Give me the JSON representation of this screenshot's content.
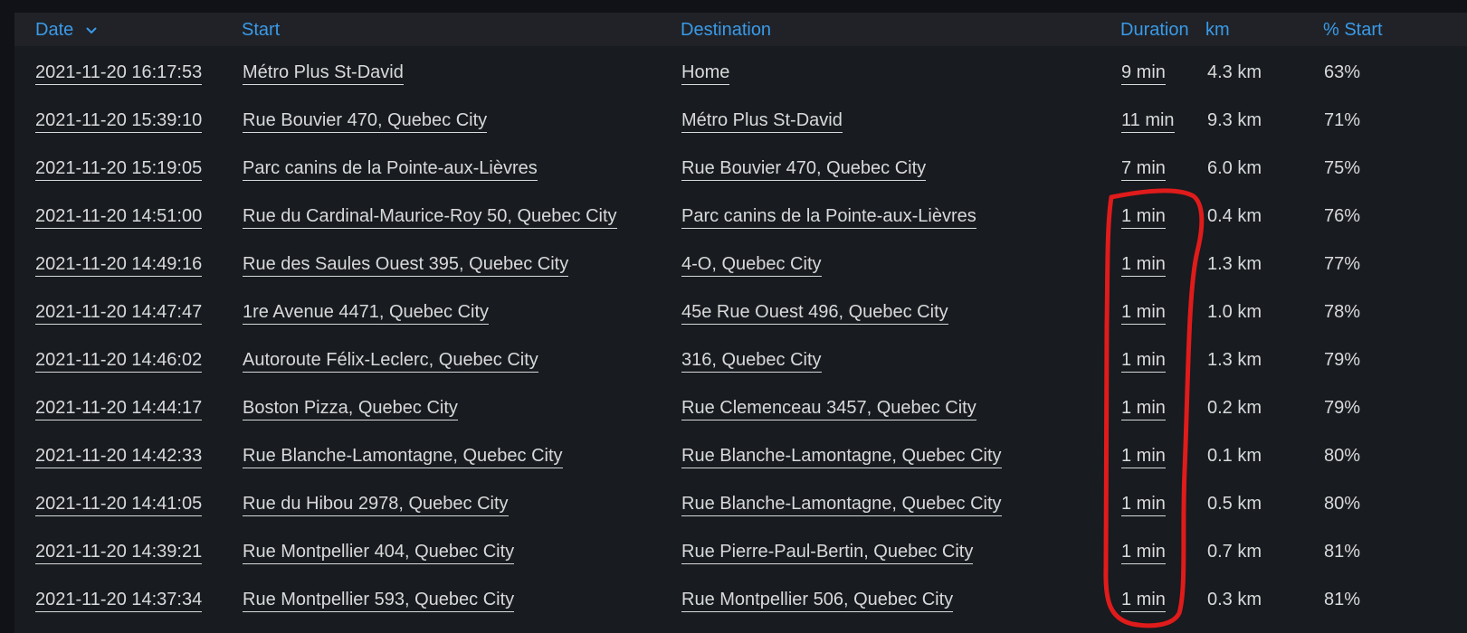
{
  "table": {
    "columns": {
      "date": "Date",
      "start": "Start",
      "destination": "Destination",
      "duration": "Duration",
      "km": "km",
      "pct_start": "% Start"
    },
    "sort_indicator_icon": "chevron-down-icon",
    "rows": [
      {
        "date": "2021-11-20 16:17:53",
        "start": "Métro Plus St-David",
        "destination": "Home",
        "duration": "9 min",
        "km": "4.3 km",
        "pct_start": "63%"
      },
      {
        "date": "2021-11-20 15:39:10",
        "start": "Rue Bouvier 470, Quebec City",
        "destination": "Métro Plus St-David",
        "duration": "11 min",
        "km": "9.3 km",
        "pct_start": "71%"
      },
      {
        "date": "2021-11-20 15:19:05",
        "start": "Parc canins de la Pointe-aux-Lièvres",
        "destination": "Rue Bouvier 470, Quebec City",
        "duration": "7 min",
        "km": "6.0 km",
        "pct_start": "75%"
      },
      {
        "date": "2021-11-20 14:51:00",
        "start": "Rue du Cardinal-Maurice-Roy 50, Quebec City",
        "destination": "Parc canins de la Pointe-aux-Lièvres",
        "duration": "1 min",
        "km": "0.4 km",
        "pct_start": "76%"
      },
      {
        "date": "2021-11-20 14:49:16",
        "start": "Rue des Saules Ouest 395, Quebec City",
        "destination": "4-O, Quebec City",
        "duration": "1 min",
        "km": "1.3 km",
        "pct_start": "77%"
      },
      {
        "date": "2021-11-20 14:47:47",
        "start": "1re Avenue 4471, Quebec City",
        "destination": "45e Rue Ouest 496, Quebec City",
        "duration": "1 min",
        "km": "1.0 km",
        "pct_start": "78%"
      },
      {
        "date": "2021-11-20 14:46:02",
        "start": "Autoroute Félix-Leclerc, Quebec City",
        "destination": "316, Quebec City",
        "duration": "1 min",
        "km": "1.3 km",
        "pct_start": "79%"
      },
      {
        "date": "2021-11-20 14:44:17",
        "start": "Boston Pizza, Quebec City",
        "destination": "Rue Clemenceau 3457, Quebec City",
        "duration": "1 min",
        "km": "0.2 km",
        "pct_start": "79%"
      },
      {
        "date": "2021-11-20 14:42:33",
        "start": "Rue Blanche-Lamontagne, Quebec City",
        "destination": "Rue Blanche-Lamontagne, Quebec City",
        "duration": "1 min",
        "km": "0.1 km",
        "pct_start": "80%"
      },
      {
        "date": "2021-11-20 14:41:05",
        "start": "Rue du Hibou 2978, Quebec City",
        "destination": "Rue Blanche-Lamontagne, Quebec City",
        "duration": "1 min",
        "km": "0.5 km",
        "pct_start": "80%"
      },
      {
        "date": "2021-11-20 14:39:21",
        "start": "Rue Montpellier 404, Quebec City",
        "destination": "Rue Pierre-Paul-Bertin, Quebec City",
        "duration": "1 min",
        "km": "0.7 km",
        "pct_start": "81%"
      },
      {
        "date": "2021-11-20 14:37:34",
        "start": "Rue Montpellier 593, Quebec City",
        "destination": "Rue Montpellier 506, Quebec City",
        "duration": "1 min",
        "km": "0.3 km",
        "pct_start": "81%"
      }
    ]
  },
  "colors": {
    "page_bg": "#111217",
    "panel_bg": "#181b1f",
    "header_bg": "#202227",
    "header_text": "#3a9ae8",
    "cell_text": "#d8d9da",
    "annotation": "#e01b1b"
  }
}
